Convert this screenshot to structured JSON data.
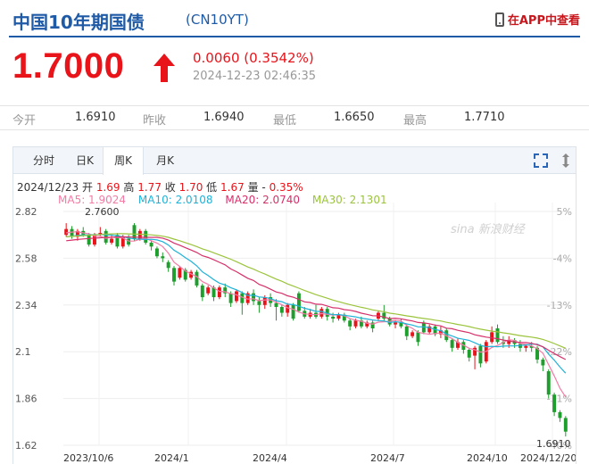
{
  "header": {
    "title": "中国10年期国债",
    "code": "(CN10YT)",
    "app_link": "在APP中查看"
  },
  "quote": {
    "price": "1.7000",
    "change": "0.0060 (0.3542%)",
    "timestamp": "2024-12-23 02:46:35"
  },
  "stats": [
    {
      "label": "今开",
      "value": "1.6910"
    },
    {
      "label": "昨收",
      "value": "1.6940"
    },
    {
      "label": "最低",
      "value": "1.6650"
    },
    {
      "label": "最高",
      "value": "1.7710"
    }
  ],
  "tabs": [
    {
      "label": "分时",
      "active": false
    },
    {
      "label": "日K",
      "active": false
    },
    {
      "label": "周K",
      "active": true
    },
    {
      "label": "月K",
      "active": false
    }
  ],
  "kline_info": {
    "date": "2024/12/23",
    "open_label": "开",
    "open": "1.69",
    "high_label": "高",
    "high": "1.77",
    "close_label": "收",
    "close": "1.70",
    "low_label": "低",
    "low": "1.67",
    "vol_label": "量",
    "vol": "-",
    "pct": "0.35%"
  },
  "ma_legend": [
    {
      "label": "MA5: 1.9024",
      "color": "#f47ba5"
    },
    {
      "label": "MA10: 2.0108",
      "color": "#1fb2d8"
    },
    {
      "label": "MA20: 2.0740",
      "color": "#d6306b"
    },
    {
      "label": "MA30: 2.1301",
      "color": "#9bc43c"
    }
  ],
  "watermark": "sina 新浪财经",
  "colors": {
    "up": "#e8141a",
    "down": "#1e9e2c",
    "brand": "#1f5aa6"
  },
  "chart_data": {
    "type": "candlestick",
    "y_ticks": [
      "2.82",
      "2.58",
      "2.34",
      "2.1",
      "1.86",
      "1.62"
    ],
    "y_tick_values": [
      2.82,
      2.58,
      2.34,
      2.1,
      1.86,
      1.62
    ],
    "pct_ticks": [
      "5%",
      "-4%",
      "-13%",
      "-22%",
      "-31%",
      "-40%"
    ],
    "x_labels": [
      "2023/10/6",
      "2024/1",
      "2024/4",
      "2024/7",
      "2024/10",
      "2024/12/20"
    ],
    "ylim": [
      1.62,
      2.82
    ],
    "max_annotation": "2.7600",
    "last_annotation": "1.6910",
    "candles": [
      [
        2.7,
        2.73,
        2.76,
        2.69
      ],
      [
        2.73,
        2.69,
        2.745,
        2.68
      ],
      [
        2.69,
        2.72,
        2.73,
        2.67
      ],
      [
        2.72,
        2.7,
        2.74,
        2.69
      ],
      [
        2.7,
        2.65,
        2.71,
        2.64
      ],
      [
        2.65,
        2.7,
        2.71,
        2.64
      ],
      [
        2.7,
        2.71,
        2.74,
        2.69
      ],
      [
        2.72,
        2.66,
        2.73,
        2.65
      ],
      [
        2.66,
        2.68,
        2.7,
        2.65
      ],
      [
        2.7,
        2.64,
        2.71,
        2.63
      ],
      [
        2.64,
        2.69,
        2.7,
        2.63
      ],
      [
        2.68,
        2.65,
        2.7,
        2.64
      ],
      [
        2.75,
        2.68,
        2.76,
        2.67
      ],
      [
        2.68,
        2.72,
        2.73,
        2.67
      ],
      [
        2.72,
        2.66,
        2.73,
        2.65
      ],
      [
        2.66,
        2.64,
        2.67,
        2.62
      ],
      [
        2.63,
        2.59,
        2.64,
        2.58
      ],
      [
        2.59,
        2.58,
        2.61,
        2.56
      ],
      [
        2.56,
        2.53,
        2.57,
        2.51
      ],
      [
        2.53,
        2.46,
        2.54,
        2.44
      ],
      [
        2.48,
        2.53,
        2.54,
        2.47
      ],
      [
        2.52,
        2.47,
        2.53,
        2.46
      ],
      [
        2.48,
        2.51,
        2.52,
        2.47
      ],
      [
        2.51,
        2.44,
        2.52,
        2.43
      ],
      [
        2.44,
        2.38,
        2.45,
        2.36
      ],
      [
        2.4,
        2.43,
        2.44,
        2.39
      ],
      [
        2.43,
        2.38,
        2.44,
        2.36
      ],
      [
        2.38,
        2.43,
        2.44,
        2.37
      ],
      [
        2.43,
        2.4,
        2.45,
        2.38
      ],
      [
        2.4,
        2.35,
        2.41,
        2.33
      ],
      [
        2.36,
        2.41,
        2.42,
        2.35
      ],
      [
        2.4,
        2.35,
        2.41,
        2.29
      ],
      [
        2.35,
        2.4,
        2.41,
        2.34
      ],
      [
        2.4,
        2.36,
        2.42,
        2.34
      ],
      [
        2.36,
        2.34,
        2.38,
        2.3
      ],
      [
        2.34,
        2.38,
        2.39,
        2.32
      ],
      [
        2.38,
        2.35,
        2.4,
        2.33
      ],
      [
        2.35,
        2.33,
        2.37,
        2.26
      ],
      [
        2.33,
        2.3,
        2.34,
        2.28
      ],
      [
        2.3,
        2.34,
        2.35,
        2.28
      ],
      [
        2.34,
        2.27,
        2.35,
        2.26
      ],
      [
        2.4,
        2.31,
        2.41,
        2.3
      ],
      [
        2.31,
        2.28,
        2.33,
        2.27
      ],
      [
        2.28,
        2.3,
        2.32,
        2.27
      ],
      [
        2.3,
        2.28,
        2.34,
        2.27
      ],
      [
        2.28,
        2.32,
        2.33,
        2.27
      ],
      [
        2.32,
        2.28,
        2.33,
        2.26
      ],
      [
        2.28,
        2.27,
        2.3,
        2.25
      ],
      [
        2.27,
        2.29,
        2.3,
        2.26
      ],
      [
        2.29,
        2.26,
        2.3,
        2.25
      ],
      [
        2.26,
        2.23,
        2.27,
        2.21
      ],
      [
        2.23,
        2.26,
        2.27,
        2.22
      ],
      [
        2.26,
        2.23,
        2.28,
        2.22
      ],
      [
        2.23,
        2.25,
        2.26,
        2.22
      ],
      [
        2.25,
        2.22,
        2.26,
        2.2
      ],
      [
        2.27,
        2.3,
        2.31,
        2.26
      ],
      [
        2.3,
        2.27,
        2.34,
        2.26
      ],
      [
        2.27,
        2.24,
        2.28,
        2.23
      ],
      [
        2.24,
        2.25,
        2.26,
        2.22
      ],
      [
        2.25,
        2.23,
        2.27,
        2.22
      ],
      [
        2.23,
        2.18,
        2.24,
        2.16
      ],
      [
        2.18,
        2.2,
        2.21,
        2.17
      ],
      [
        2.2,
        2.15,
        2.21,
        2.13
      ],
      [
        2.25,
        2.2,
        2.26,
        2.19
      ],
      [
        2.2,
        2.23,
        2.24,
        2.19
      ],
      [
        2.23,
        2.19,
        2.24,
        2.18
      ],
      [
        2.19,
        2.21,
        2.23,
        2.17
      ],
      [
        2.21,
        2.16,
        2.22,
        2.15
      ],
      [
        2.16,
        2.12,
        2.17,
        2.1
      ],
      [
        2.12,
        2.15,
        2.17,
        2.11
      ],
      [
        2.15,
        2.11,
        2.16,
        2.09
      ],
      [
        2.11,
        2.07,
        2.12,
        2.05
      ],
      [
        2.08,
        2.12,
        2.13,
        2.01
      ],
      [
        2.13,
        2.04,
        2.14,
        2.02
      ],
      [
        2.05,
        2.15,
        2.16,
        2.04
      ],
      [
        2.15,
        2.2,
        2.23,
        2.14
      ],
      [
        2.22,
        2.15,
        2.24,
        2.14
      ],
      [
        2.15,
        2.14,
        2.18,
        2.12
      ],
      [
        2.14,
        2.16,
        2.18,
        2.12
      ],
      [
        2.16,
        2.14,
        2.17,
        2.12
      ],
      [
        2.14,
        2.12,
        2.16,
        2.1
      ],
      [
        2.12,
        2.13,
        2.14,
        2.1
      ],
      [
        2.13,
        2.12,
        2.15,
        2.1
      ],
      [
        2.12,
        2.06,
        2.13,
        2.04
      ],
      [
        2.06,
        2.03,
        2.07,
        2.0
      ],
      [
        2.0,
        1.88,
        2.01,
        1.86
      ],
      [
        1.88,
        1.79,
        1.89,
        1.77
      ],
      [
        1.79,
        1.76,
        1.8,
        1.74
      ],
      [
        1.76,
        1.69,
        1.77,
        1.665
      ]
    ],
    "series": [
      {
        "name": "MA5",
        "color": "#f47ba5",
        "values": [
          2.71,
          2.714,
          2.716,
          2.71,
          2.706,
          2.694,
          2.692,
          2.682,
          2.688,
          2.686,
          2.684,
          2.668,
          2.668,
          2.678,
          2.682,
          2.67,
          2.658,
          2.64,
          2.606,
          2.56,
          2.538,
          2.514,
          2.5,
          2.486,
          2.46,
          2.446,
          2.428,
          2.41,
          2.408,
          2.398,
          2.392,
          2.38,
          2.37,
          2.372,
          2.362,
          2.366,
          2.366,
          2.354,
          2.342,
          2.326,
          2.318,
          2.304,
          2.294,
          2.292,
          2.29,
          2.296,
          2.292,
          2.288,
          2.29,
          2.284,
          2.27,
          2.262,
          2.256,
          2.246,
          2.242,
          2.252,
          2.254,
          2.256,
          2.262,
          2.258,
          2.234,
          2.22,
          2.2,
          2.194,
          2.19,
          2.194,
          2.196,
          2.182,
          2.168,
          2.148,
          2.134,
          2.118,
          2.11,
          2.098,
          2.102,
          2.122,
          2.132,
          2.148,
          2.162,
          2.158,
          2.142,
          2.138,
          2.13,
          2.116,
          2.092,
          2.034,
          1.976,
          1.912,
          1.868
        ]
      },
      {
        "name": "MA10",
        "color": "#1fb2d8",
        "values": [
          2.69,
          2.693,
          2.697,
          2.699,
          2.7,
          2.701,
          2.702,
          2.7,
          2.699,
          2.695,
          2.69,
          2.684,
          2.679,
          2.678,
          2.676,
          2.677,
          2.674,
          2.665,
          2.648,
          2.621,
          2.604,
          2.583,
          2.564,
          2.541,
          2.51,
          2.491,
          2.47,
          2.452,
          2.443,
          2.429,
          2.418,
          2.404,
          2.389,
          2.39,
          2.381,
          2.379,
          2.373,
          2.362,
          2.357,
          2.344,
          2.342,
          2.334,
          2.323,
          2.316,
          2.307,
          2.307,
          2.297,
          2.29,
          2.291,
          2.287,
          2.283,
          2.279,
          2.272,
          2.268,
          2.263,
          2.26,
          2.258,
          2.25,
          2.254,
          2.25,
          2.243,
          2.237,
          2.228,
          2.228,
          2.224,
          2.214,
          2.208,
          2.191,
          2.181,
          2.169,
          2.164,
          2.158,
          2.146,
          2.133,
          2.125,
          2.128,
          2.125,
          2.129,
          2.13,
          2.13,
          2.132,
          2.135,
          2.139,
          2.139,
          2.125,
          2.088,
          2.057,
          2.021,
          1.99
        ]
      },
      {
        "name": "MA20",
        "color": "#d6306b",
        "values": [
          2.67,
          2.673,
          2.676,
          2.679,
          2.681,
          2.683,
          2.685,
          2.687,
          2.688,
          2.689,
          2.69,
          2.689,
          2.688,
          2.687,
          2.687,
          2.687,
          2.687,
          2.683,
          2.673,
          2.658,
          2.647,
          2.634,
          2.622,
          2.61,
          2.593,
          2.584,
          2.572,
          2.559,
          2.546,
          2.525,
          2.511,
          2.494,
          2.477,
          2.466,
          2.446,
          2.435,
          2.421,
          2.407,
          2.4,
          2.387,
          2.38,
          2.369,
          2.356,
          2.353,
          2.344,
          2.343,
          2.335,
          2.326,
          2.324,
          2.316,
          2.313,
          2.307,
          2.298,
          2.292,
          2.285,
          2.284,
          2.278,
          2.27,
          2.272,
          2.269,
          2.263,
          2.258,
          2.25,
          2.248,
          2.244,
          2.237,
          2.233,
          2.221,
          2.218,
          2.21,
          2.204,
          2.198,
          2.187,
          2.181,
          2.175,
          2.171,
          2.167,
          2.16,
          2.156,
          2.15,
          2.148,
          2.147,
          2.143,
          2.136,
          2.125,
          2.108,
          2.091,
          2.075,
          2.06
        ]
      },
      {
        "name": "MA30",
        "color": "#9bc43c",
        "values": [
          2.69,
          2.692,
          2.694,
          2.696,
          2.698,
          2.7,
          2.702,
          2.704,
          2.705,
          2.706,
          2.706,
          2.705,
          2.704,
          2.703,
          2.702,
          2.7,
          2.697,
          2.693,
          2.687,
          2.678,
          2.67,
          2.66,
          2.65,
          2.64,
          2.628,
          2.619,
          2.608,
          2.597,
          2.586,
          2.575,
          2.562,
          2.549,
          2.535,
          2.524,
          2.511,
          2.499,
          2.486,
          2.473,
          2.462,
          2.448,
          2.437,
          2.426,
          2.414,
          2.404,
          2.393,
          2.384,
          2.375,
          2.365,
          2.357,
          2.349,
          2.342,
          2.335,
          2.328,
          2.322,
          2.315,
          2.31,
          2.305,
          2.298,
          2.294,
          2.289,
          2.284,
          2.28,
          2.275,
          2.271,
          2.267,
          2.262,
          2.258,
          2.251,
          2.246,
          2.24,
          2.235,
          2.229,
          2.222,
          2.216,
          2.211,
          2.206,
          2.202,
          2.197,
          2.193,
          2.188,
          2.183,
          2.179,
          2.175,
          2.17,
          2.163,
          2.153,
          2.142,
          2.13,
          2.118
        ]
      }
    ]
  }
}
